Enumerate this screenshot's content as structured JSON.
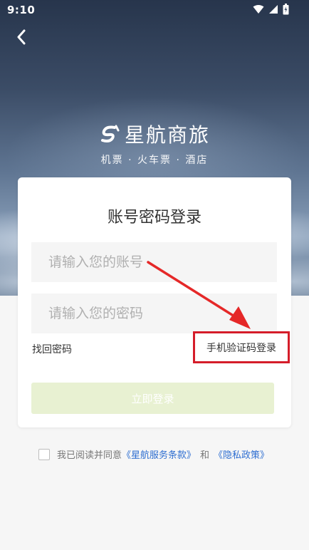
{
  "status_bar": {
    "time": "9:10",
    "icons": [
      "wifi-icon",
      "signal-icon",
      "battery-icon"
    ]
  },
  "brand": {
    "name": "星航商旅",
    "tagline": "机票 · 火车票 · 酒店"
  },
  "login_card": {
    "title": "账号密码登录",
    "account_placeholder": "请输入您的账号",
    "password_placeholder": "请输入您的密码",
    "forgot_password": "找回密码",
    "sms_login": "手机验证码登录",
    "submit_label": "立即登录"
  },
  "agreement": {
    "prefix": "我已阅读并同意",
    "terms_link": "《星航服务条款》",
    "and": "和",
    "privacy_link": "《隐私政策》"
  },
  "colors": {
    "highlight_box": "#d51d2a",
    "link": "#2f6fd1",
    "login_button_disabled": "#e8f1d2"
  }
}
